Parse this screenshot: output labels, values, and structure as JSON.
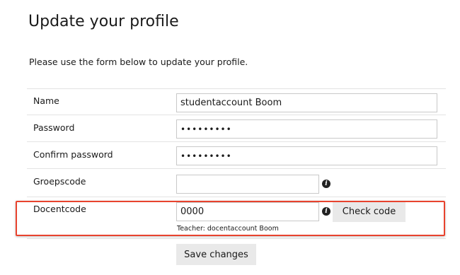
{
  "page": {
    "title": "Update your profile",
    "intro": "Please use the form below to update your profile."
  },
  "form": {
    "name": {
      "label": "Name",
      "value": "studentaccount Boom"
    },
    "password": {
      "label": "Password",
      "value": "•••••••••"
    },
    "confirm_password": {
      "label": "Confirm password",
      "value": "•••••••••"
    },
    "groepscode": {
      "label": "Groepscode",
      "value": "",
      "info_icon": "info-icon"
    },
    "docentcode": {
      "label": "Docentcode",
      "value": "0000",
      "info_icon": "info-icon",
      "check_button_label": "Check code",
      "helper_text": "Teacher: docentaccount Boom"
    },
    "save_button_label": "Save changes"
  },
  "colors": {
    "highlight_border": "#e8432e",
    "button_bg": "#e9e9e9",
    "row_divider": "#e3e3e3"
  }
}
